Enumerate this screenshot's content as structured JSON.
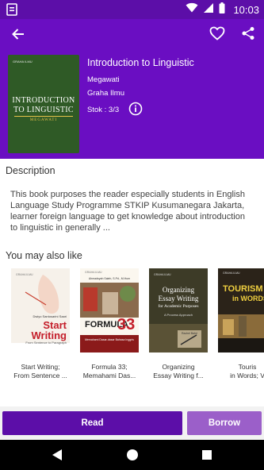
{
  "status_bar": {
    "time": "10:03"
  },
  "book": {
    "title": "Introduction to Linguistic",
    "author": "Megawati",
    "publisher": "Graha Ilmu",
    "stock": "Stok : 3/3",
    "cover": {
      "publisher_mark": "GRAHA ILMU",
      "title_line1": "INTRODUCTION",
      "title_line2": "TO LINGUISTIC",
      "author": "MEGAWATI",
      "color": "#2f5a26"
    }
  },
  "description": {
    "heading": "Description",
    "text": "This book purposes the reader especially students in English Language Study Programme STKIP Kusumanegara Jakarta, learner foreign language to get knowledge about introduction to linguistic in generally ..."
  },
  "recommendations": {
    "heading": "You may also like",
    "items": [
      {
        "label_line1": "Start Writing;",
        "label_line2": "From Sentence ...",
        "cover": {
          "title": "Start",
          "title2": "Writing",
          "subtitle": "From Sentence to Paragraph",
          "author": "Dwiyo Santosarini Saari"
        }
      },
      {
        "label_line1": "Formula 33;",
        "label_line2": "Memahami Das...",
        "cover": {
          "title": "FORMULA",
          "number": "33",
          "subtitle": "Memahami Dasar-dasar Bahasa Inggris",
          "author": "Ahmadsyah Saleh, S.Pd., M.Hum"
        }
      },
      {
        "label_line1": "Organizing",
        "label_line2": "Essay Writing f...",
        "cover": {
          "title": "Organizing",
          "title2": "Essay Writing",
          "title3": "for Academic Purposes",
          "subtitle": "A Process Approach",
          "author": "Rachel Bahri"
        }
      },
      {
        "label_line1": "Touris",
        "label_line2": "in Words; V",
        "cover": {
          "title": "TOURISM",
          "title2": "in WORDS"
        }
      }
    ]
  },
  "actions": {
    "read": "Read",
    "borrow": "Borrow"
  },
  "colors": {
    "primary": "#6a0ec2",
    "primary_dark": "#5c0ea8",
    "accent": "#9b5fc9"
  }
}
